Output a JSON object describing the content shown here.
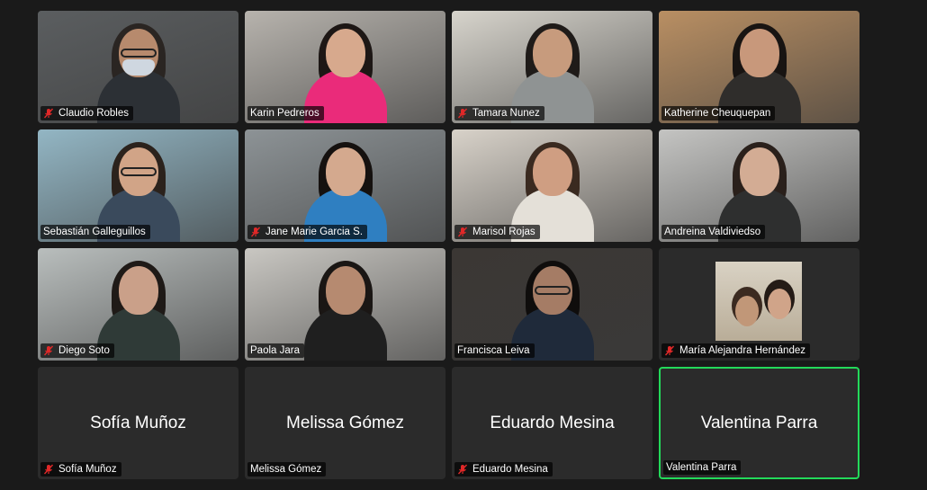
{
  "meeting": {
    "participants": [
      {
        "name": "Claudio Robles",
        "muted": true,
        "video": true,
        "bg": "#5b5e60",
        "skin": "#b78a6d",
        "hair_color": "#2a2522",
        "shirt": "#2c3035",
        "accessory": "glasses-mask"
      },
      {
        "name": "Karin Pedreros",
        "muted": false,
        "video": true,
        "bg": "#b7b3ad",
        "skin": "#d7a98d",
        "hair_color": "#1d1715",
        "shirt": "#ea2b7a",
        "accessory": "none"
      },
      {
        "name": "Tamara Nunez",
        "muted": true,
        "video": true,
        "bg": "#d7d4cc",
        "skin": "#c79b7d",
        "hair_color": "#1f1b19",
        "shirt": "#8f9393",
        "accessory": "none"
      },
      {
        "name": "Katherine Cheuquepan",
        "muted": false,
        "video": true,
        "bg": "#b98f63",
        "skin": "#c8987b",
        "hair_color": "#181412",
        "shirt": "#2f2d2b",
        "accessory": "none"
      },
      {
        "name": "Sebastián Galleguillos",
        "muted": false,
        "video": true,
        "bg": "#93b6c4",
        "skin": "#d1a487",
        "hair_color": "#2b221c",
        "shirt": "#3a4a5c",
        "accessory": "glasses"
      },
      {
        "name": "Jane Marie Garcia S.",
        "muted": true,
        "video": true,
        "bg": "#8d9396",
        "skin": "#d4a98e",
        "hair_color": "#15110f",
        "shirt": "#2f7fc1",
        "accessory": "none"
      },
      {
        "name": "Marisol Rojas",
        "muted": true,
        "video": true,
        "bg": "#d8d2c9",
        "skin": "#cf9e82",
        "hair_color": "#3a2a20",
        "shirt": "#e4e0d8",
        "accessory": "none"
      },
      {
        "name": "Andreina Valdiviedso",
        "muted": false,
        "video": true,
        "bg": "#c4c4c2",
        "skin": "#d3ac94",
        "hair_color": "#2a201b",
        "shirt": "#2e2f2f",
        "accessory": "none"
      },
      {
        "name": "Diego Soto",
        "muted": true,
        "video": true,
        "bg": "#b9bebd",
        "skin": "#caa089",
        "hair_color": "#1f1a17",
        "shirt": "#2f3a37",
        "accessory": "none"
      },
      {
        "name": "Paola Jara",
        "muted": false,
        "video": true,
        "bg": "#c9c7c2",
        "skin": "#b68a70",
        "hair_color": "#1a1614",
        "shirt": "#1f1f1f",
        "accessory": "none"
      },
      {
        "name": "Francisca Leiva",
        "muted": false,
        "video": true,
        "bg": "#3b3734",
        "skin": "#a57c65",
        "hair_color": "#0f0d0c",
        "shirt": "#1f2a3a",
        "accessory": "glasses"
      },
      {
        "name": "María Alejandra Hernández",
        "muted": true,
        "video": false,
        "avatar_photo": true
      },
      {
        "name": "Sofía Muñoz",
        "muted": true,
        "video": false,
        "center_name": "Sofía Muñoz"
      },
      {
        "name": "Melissa Gómez",
        "muted": false,
        "video": false,
        "center_name": "Melissa Gómez"
      },
      {
        "name": "Eduardo Mesina",
        "muted": true,
        "video": false,
        "center_name": "Eduardo Mesina"
      },
      {
        "name": "Valentina Parra",
        "muted": false,
        "video": false,
        "center_name": "Valentina Parra",
        "active_speaker": true
      }
    ]
  },
  "colors": {
    "background": "#1a1a1a",
    "tile_bg": "#2b2b2b",
    "active_border": "#23d95a",
    "muted_icon": "#e02828",
    "label_text": "#ffffff"
  },
  "icons": {
    "muted_mic": "mic-muted-icon"
  }
}
